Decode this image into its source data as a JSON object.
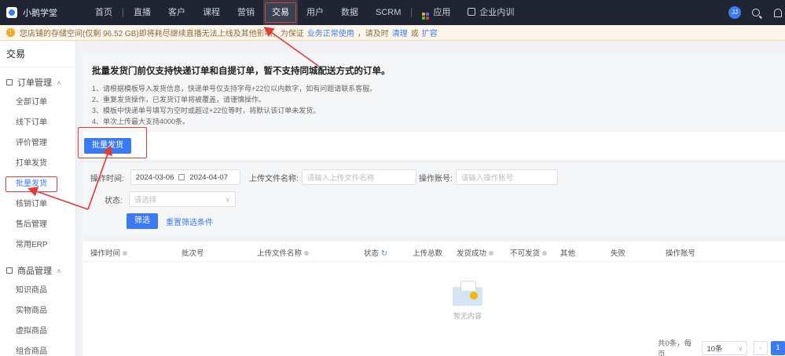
{
  "brand": {
    "name": "小鹅学堂"
  },
  "nav": {
    "items": [
      "首页",
      "直播",
      "客户",
      "课程",
      "营销",
      "交易",
      "用户",
      "数据",
      "SCRM"
    ],
    "active_index": 5,
    "apps": "应用",
    "enterprise": "企业内训"
  },
  "top_right": {
    "avatar": "JJ"
  },
  "notice": {
    "text": "您店铺的存储空间(仅剩 96.52 GB)即将耗尽继续直播无法上线及其他影响，为保证",
    "link1": "业务正常使用",
    "mid": "，请及时",
    "link2": "清理",
    "or": "或",
    "link3": "扩容"
  },
  "sidebar": {
    "title": "交易",
    "group1": "订单管理",
    "group1_items": [
      "全部订单",
      "线下订单",
      "评价管理",
      "打单发货",
      "批量发货",
      "核销订单",
      "售后管理",
      "常用ERP"
    ],
    "active_item_index": 4,
    "group2": "商品管理",
    "group2_items": [
      "知识商品",
      "实物商品",
      "虚拟商品",
      "组合商品"
    ]
  },
  "info": {
    "title": "批量发货门前仅支持快递订单和自提订单，暂不支持同城配送方式的订单。",
    "lines": [
      "1、请根据模板导入发货信息，快递单号仅支持字母+22位以内数字，如有问题请联系客服。",
      "2、重复发货操作，已发货订单将被覆盖，请谨慎操作。",
      "3、模板中快递单号填写为空时或超过+22位等时，将默认该订单未发货。",
      "4、单次上传最大支持4000条。"
    ]
  },
  "actions": {
    "batch_send": "批量发货"
  },
  "filter": {
    "time_label": "操作时间:",
    "date_start": "2024-03-06",
    "date_sep": "至",
    "date_end": "2024-04-07",
    "file_label": "上传文件名称:",
    "file_placeholder": "请输入上传文件名称",
    "operator_label": "操作账号:",
    "operator_placeholder": "请输入操作账号",
    "status_label": "状态:",
    "status_placeholder": "请选择",
    "filter_button": "筛选",
    "reset_button": "重置筛选条件"
  },
  "table": {
    "columns": [
      "操作时间",
      "批次号",
      "上传文件名称",
      "状态",
      "上传总数",
      "发货成功",
      "不可发货",
      "其他",
      "失败",
      "操作账号"
    ],
    "empty_text": "暂无内容"
  },
  "pager": {
    "total": "共0条，每页",
    "size": "10条",
    "current": "1"
  },
  "colors": {
    "accent": "#3a7bf5",
    "highlight": "#e53935",
    "nav_bg": "#1f2532"
  }
}
